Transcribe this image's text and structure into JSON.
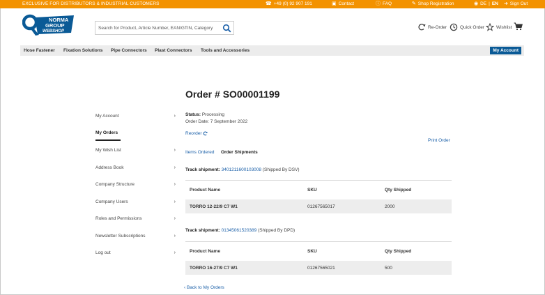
{
  "topbar": {
    "tagline": "EXCLUSIVE FOR DISTRIBUTORS & INDUSTRIAL CUSTOMERS",
    "phone": "+49 (0) 92 907 191",
    "contact": "Contact",
    "faq": "FAQ",
    "shop_registration": "Shop Registration",
    "lang_de": "DE",
    "lang_sep": "|",
    "lang_en": "EN",
    "sign_out": "Sign Out"
  },
  "logo": {
    "line1": "NORMA",
    "line2": "GROUP",
    "line3": "WEBSHOP"
  },
  "search": {
    "placeholder": "Search for Product, Article Number, EAN/GTIN, Category"
  },
  "header_actions": {
    "reorder": "Re-Order",
    "quick_order": "Quick Order",
    "wishlist": "Wishlist"
  },
  "nav": {
    "items": [
      "Hose Fastener",
      "Fixation Solutions",
      "Pipe Connectors",
      "Plast Connectors",
      "Tools and Accessories"
    ],
    "my_account": "My Account"
  },
  "sidebar": {
    "items": [
      {
        "label": "My Account"
      },
      {
        "label": "My Orders"
      },
      {
        "label": "My Wish List"
      },
      {
        "label": "Address Book"
      },
      {
        "label": "Company Structure"
      },
      {
        "label": "Company Users"
      },
      {
        "label": "Roles and Permissions"
      },
      {
        "label": "Newsletter Subscriptions"
      },
      {
        "label": "Log out"
      }
    ]
  },
  "order": {
    "title": "Order # SO00001199",
    "status_label": "Status:",
    "status_value": "Processing",
    "order_date": "Order Date: 7 September 2022",
    "reorder": "Reorder",
    "print_order": "Print Order",
    "tab_items": "Items Ordered",
    "tab_shipments": "Order Shipments",
    "back": "Back to My Orders"
  },
  "columns": {
    "product": "Product Name",
    "sku": "SKU",
    "qty": "Qty Shipped"
  },
  "shipments": [
    {
      "label": "Track shipment:",
      "tracking": "3401211600103008",
      "carrier": "(Shipped By DSV)",
      "rows": [
        {
          "product": "TORRO 12-22/9 C7 W1",
          "sku": "01267565017",
          "qty": "2000"
        }
      ]
    },
    {
      "label": "Track shipment:",
      "tracking": "01345061520389",
      "carrier": "(Shipped By DPD)",
      "rows": [
        {
          "product": "TORRO 16-27/9 C7 W1",
          "sku": "01267565021",
          "qty": "500"
        }
      ]
    }
  ],
  "colors": {
    "accent_orange": "#f39200",
    "brand_blue": "#0a5a96",
    "link_blue": "#1a5fa8"
  }
}
